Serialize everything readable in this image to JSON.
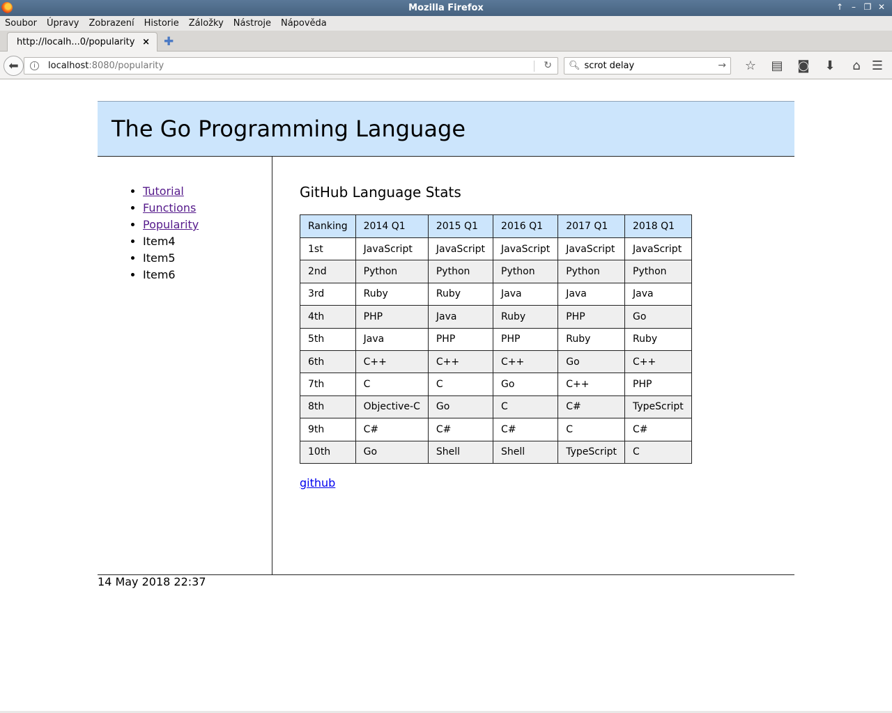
{
  "window": {
    "title": "Mozilla Firefox"
  },
  "menu": [
    "Soubor",
    "Úpravy",
    "Zobrazení",
    "Historie",
    "Záložky",
    "Nástroje",
    "Nápověda"
  ],
  "tab": {
    "title": "http://localh...0/popularity",
    "close": "×"
  },
  "urlbar": {
    "host": "localhost",
    "rest": ":8080/popularity"
  },
  "searchbar": {
    "value": "scrot delay"
  },
  "page": {
    "title": "The Go Programming Language",
    "nav": [
      {
        "label": "Tutorial",
        "link": true
      },
      {
        "label": "Functions",
        "link": true
      },
      {
        "label": "Popularity",
        "link": true
      },
      {
        "label": "Item4",
        "link": false
      },
      {
        "label": "Item5",
        "link": false
      },
      {
        "label": "Item6",
        "link": false
      }
    ],
    "heading": "GitHub Language Stats",
    "table": {
      "headers": [
        "Ranking",
        "2014 Q1",
        "2015 Q1",
        "2016 Q1",
        "2017 Q1",
        "2018 Q1"
      ],
      "rows": [
        [
          "1st",
          "JavaScript",
          "JavaScript",
          "JavaScript",
          "JavaScript",
          "JavaScript"
        ],
        [
          "2nd",
          "Python",
          "Python",
          "Python",
          "Python",
          "Python"
        ],
        [
          "3rd",
          "Ruby",
          "Ruby",
          "Java",
          "Java",
          "Java"
        ],
        [
          "4th",
          "PHP",
          "Java",
          "Ruby",
          "PHP",
          "Go"
        ],
        [
          "5th",
          "Java",
          "PHP",
          "PHP",
          "Ruby",
          "Ruby"
        ],
        [
          "6th",
          "C++",
          "C++",
          "C++",
          "Go",
          "C++"
        ],
        [
          "7th",
          "C",
          "C",
          "Go",
          "C++",
          "PHP"
        ],
        [
          "8th",
          "Objective-C",
          "Go",
          "C",
          "C#",
          "TypeScript"
        ],
        [
          "9th",
          "C#",
          "C#",
          "C#",
          "C",
          "C#"
        ],
        [
          "10th",
          "Go",
          "Shell",
          "Shell",
          "TypeScript",
          "C"
        ]
      ]
    },
    "link": "github",
    "footer": "14 May 2018 22:37"
  }
}
